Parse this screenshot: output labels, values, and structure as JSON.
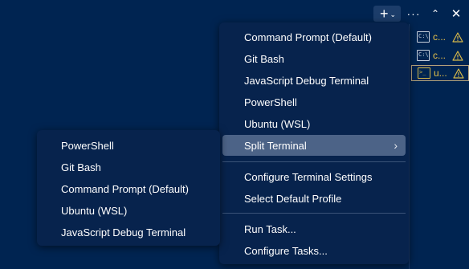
{
  "toolbar": {
    "new_terminal_icon": "plus-icon",
    "new_terminal_dropdown_icon": "chevron-down-icon",
    "more_actions_icon": "ellipsis-icon",
    "maximize_icon": "chevron-up-icon",
    "close_icon": "close-icon",
    "new_terminal_glyph": "+",
    "chevron_glyph": "⌄",
    "more_glyph": "···",
    "up_glyph": "⌃",
    "close_glyph": "✕"
  },
  "terminal_tabs": [
    {
      "icon": "cmd-terminal-icon",
      "icon_text": "C:\\",
      "label": "c...",
      "warning_icon": "warning-icon",
      "selected": false
    },
    {
      "icon": "cmd-terminal-icon",
      "icon_text": "C:\\",
      "label": "c...",
      "warning_icon": "warning-icon",
      "selected": false
    },
    {
      "icon": "shell-terminal-icon",
      "icon_text": ">_",
      "label": "u...",
      "warning_icon": "warning-icon",
      "selected": true
    }
  ],
  "main_menu": {
    "items": [
      {
        "label": "Command Prompt (Default)"
      },
      {
        "label": "Git Bash"
      },
      {
        "label": "JavaScript Debug Terminal"
      },
      {
        "label": "PowerShell"
      },
      {
        "label": "Ubuntu (WSL)"
      },
      {
        "label": "Split Terminal",
        "highlighted": true,
        "submenu_icon": "chevron-right-icon",
        "arrow": "›"
      },
      {
        "label": "Configure Terminal Settings"
      },
      {
        "label": "Select Default Profile"
      },
      {
        "label": "Run Task..."
      },
      {
        "label": "Configure Tasks..."
      }
    ]
  },
  "split_submenu": {
    "items": [
      {
        "label": "PowerShell"
      },
      {
        "label": "Git Bash"
      },
      {
        "label": "Command Prompt (Default)"
      },
      {
        "label": "Ubuntu (WSL)"
      },
      {
        "label": "JavaScript Debug Terminal"
      }
    ]
  },
  "colors": {
    "background": "#002451",
    "menu_background": "#07234d",
    "highlight": "#4c6387",
    "tab_label": "#e8c34a",
    "warning": "#d7b94a",
    "error_marker": "#e0484b"
  }
}
